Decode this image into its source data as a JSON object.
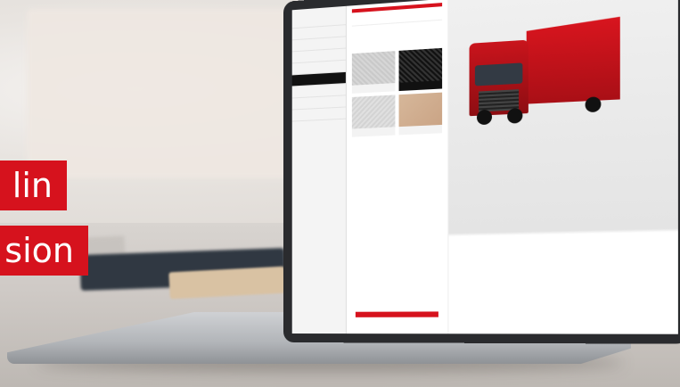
{
  "caption": {
    "line1": "lin",
    "line2": "sion"
  },
  "colors": {
    "accent": "#d6121d"
  }
}
